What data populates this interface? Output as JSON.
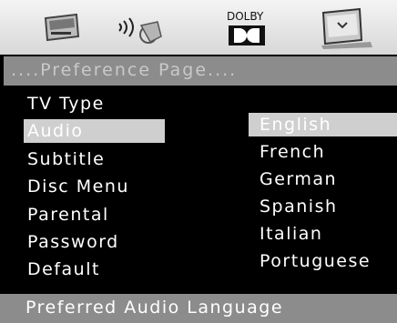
{
  "icons": {
    "general_setup": "tv-setup-icon",
    "audio_setup": "speaker-audio-icon",
    "dolby": {
      "name": "dolby-icon",
      "label": "DOLBY"
    },
    "preference": "preference-page-icon"
  },
  "header": {
    "title": "....Preference Page...."
  },
  "menu": {
    "items": [
      {
        "label": "TV Type"
      },
      {
        "label": "Audio"
      },
      {
        "label": "Subtitle"
      },
      {
        "label": "Disc Menu"
      },
      {
        "label": "Parental"
      },
      {
        "label": "Password"
      },
      {
        "label": "Default"
      }
    ],
    "selected": "Audio"
  },
  "options": {
    "items": [
      {
        "label": "English"
      },
      {
        "label": "French"
      },
      {
        "label": "German"
      },
      {
        "label": "Spanish"
      },
      {
        "label": "Italian"
      },
      {
        "label": "Portuguese"
      }
    ],
    "selected": "English"
  },
  "status": {
    "text": "Preferred Audio Language"
  },
  "colors": {
    "background": "#000000",
    "highlight": "#cfcfcf",
    "bar": "#8c8c8c",
    "icon_bar": "#e6e6e6"
  }
}
